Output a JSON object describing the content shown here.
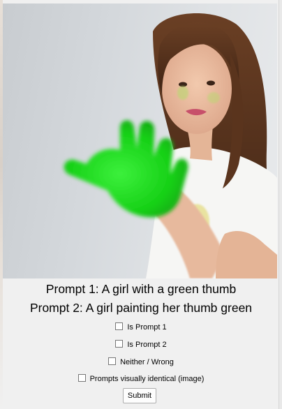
{
  "image": {
    "description_icon": "photo-girl-green-paint-hand"
  },
  "prompts": {
    "prompt1": "Prompt 1: A girl with a green thumb",
    "prompt2": "Prompt 2: A girl painting her thumb green"
  },
  "options": [
    {
      "label": "Is Prompt 1",
      "checked": false
    },
    {
      "label": "Is Prompt 2",
      "checked": false
    },
    {
      "label": "Neither / Wrong",
      "checked": false
    },
    {
      "label": "Prompts visually identical (image)",
      "checked": false
    }
  ],
  "submit_label": "Submit",
  "colors": {
    "paint_green": "#22dd22",
    "background": "#f0f0f0"
  }
}
